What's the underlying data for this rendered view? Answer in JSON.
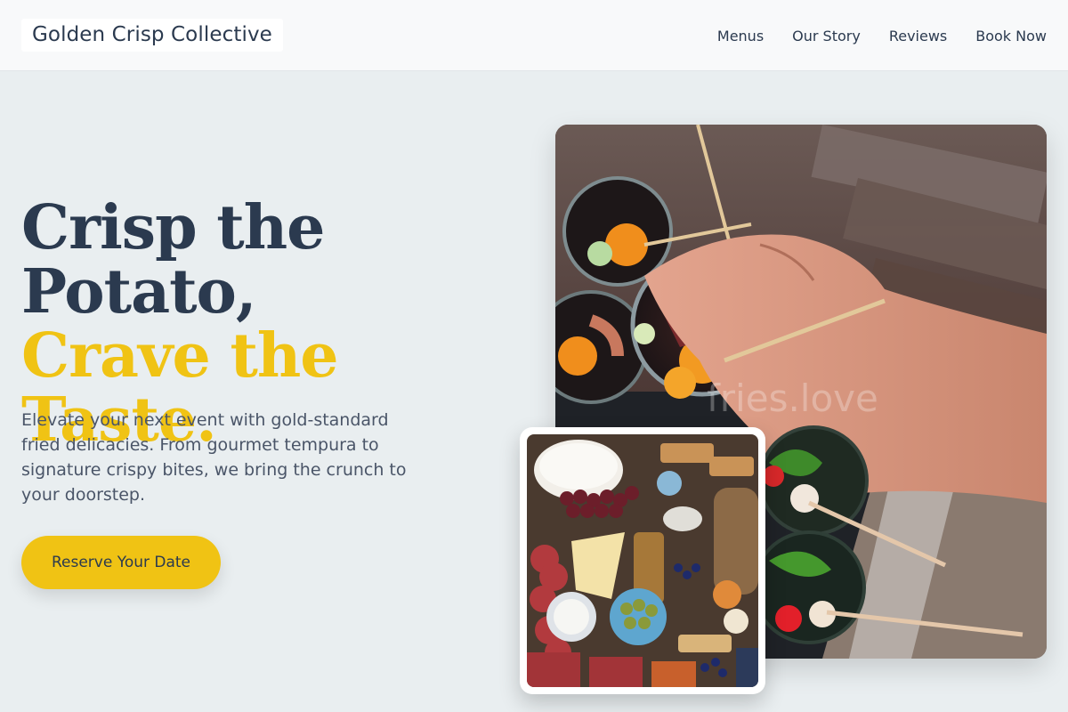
{
  "header": {
    "brand": "Golden Crisp Collective",
    "nav": [
      "Menus",
      "Our Story",
      "Reviews",
      "Book Now"
    ]
  },
  "hero": {
    "headline_line1": "Crisp the",
    "headline_line2": "Potato,",
    "headline_accent": "Crave the Taste.",
    "lede": "Elevate your next event with gold-standard fried delicacies. From gourmet tempura to signature crispy bites, we bring the crunch to your doorstep.",
    "cta_label": "Reserve Your Date"
  },
  "photos": {
    "main_watermark": "fries.love"
  },
  "colors": {
    "accent": "#f0c314",
    "text": "#2b3a4f",
    "background": "#e9eef0"
  }
}
